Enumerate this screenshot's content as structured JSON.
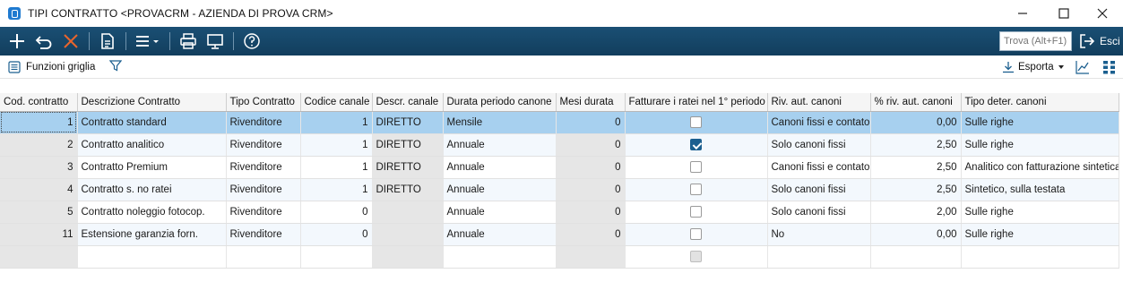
{
  "window": {
    "title": "TIPI CONTRATTO <PROVACRM - AZIENDA DI PROVA CRM>",
    "controls": [
      "minimize",
      "maximize",
      "close"
    ]
  },
  "toolbar": {
    "buttons": [
      "add-icon",
      "undo-icon",
      "delete-icon",
      "document-icon",
      "menu-icon",
      "print-icon",
      "monitor-icon",
      "help-icon"
    ],
    "find_placeholder": "Trova (Alt+F1)",
    "exit_label": "Esci"
  },
  "subbar": {
    "functions_label": "Funzioni griglia",
    "export_label": "Esporta"
  },
  "grid": {
    "columns": [
      "Cod. contratto",
      "Descrizione Contratto",
      "Tipo Contratto",
      "Codice canale",
      "Descr. canale",
      "Durata periodo canone",
      "Mesi durata",
      "Fatturare i ratei nel 1° periodo",
      "Riv. aut. canoni",
      "% riv. aut. canoni",
      "Tipo deter. canoni"
    ],
    "rows": [
      {
        "cod": "1",
        "descr": "Contratto standard",
        "tipo": "Rivenditore",
        "canale": "1",
        "descr_canale": "DIRETTO",
        "durata": "Mensile",
        "mesi": "0",
        "ratei": false,
        "riv": "Canoni fissi e contatori",
        "perc": "0,00",
        "deter": "Sulle righe",
        "selected": true
      },
      {
        "cod": "2",
        "descr": "Contratto analitico",
        "tipo": "Rivenditore",
        "canale": "1",
        "descr_canale": "DIRETTO",
        "durata": "Annuale",
        "mesi": "0",
        "ratei": true,
        "riv": "Solo canoni fissi",
        "perc": "2,50",
        "deter": "Sulle righe"
      },
      {
        "cod": "3",
        "descr": "Contratto Premium",
        "tipo": "Rivenditore",
        "canale": "1",
        "descr_canale": "DIRETTO",
        "durata": "Annuale",
        "mesi": "0",
        "ratei": false,
        "riv": "Canoni fissi e contatori",
        "perc": "2,50",
        "deter": "Analitico con fatturazione sintetica"
      },
      {
        "cod": "4",
        "descr": "Contratto s. no ratei",
        "tipo": "Rivenditore",
        "canale": "1",
        "descr_canale": "DIRETTO",
        "durata": "Annuale",
        "mesi": "0",
        "ratei": false,
        "riv": "Solo canoni fissi",
        "perc": "2,50",
        "deter": "Sintetico, sulla testata"
      },
      {
        "cod": "5",
        "descr": "Contratto noleggio fotocop.",
        "tipo": "Rivenditore",
        "canale": "0",
        "descr_canale": "",
        "durata": "Annuale",
        "mesi": "0",
        "ratei": false,
        "riv": "Solo canoni fissi",
        "perc": "2,00",
        "deter": "Sulle righe"
      },
      {
        "cod": "11",
        "descr": "Estensione garanzia forn.",
        "tipo": "Rivenditore",
        "canale": "0",
        "descr_canale": "",
        "durata": "Annuale",
        "mesi": "0",
        "ratei": false,
        "riv": "No",
        "perc": "0,00",
        "deter": "Sulle righe"
      }
    ]
  }
}
